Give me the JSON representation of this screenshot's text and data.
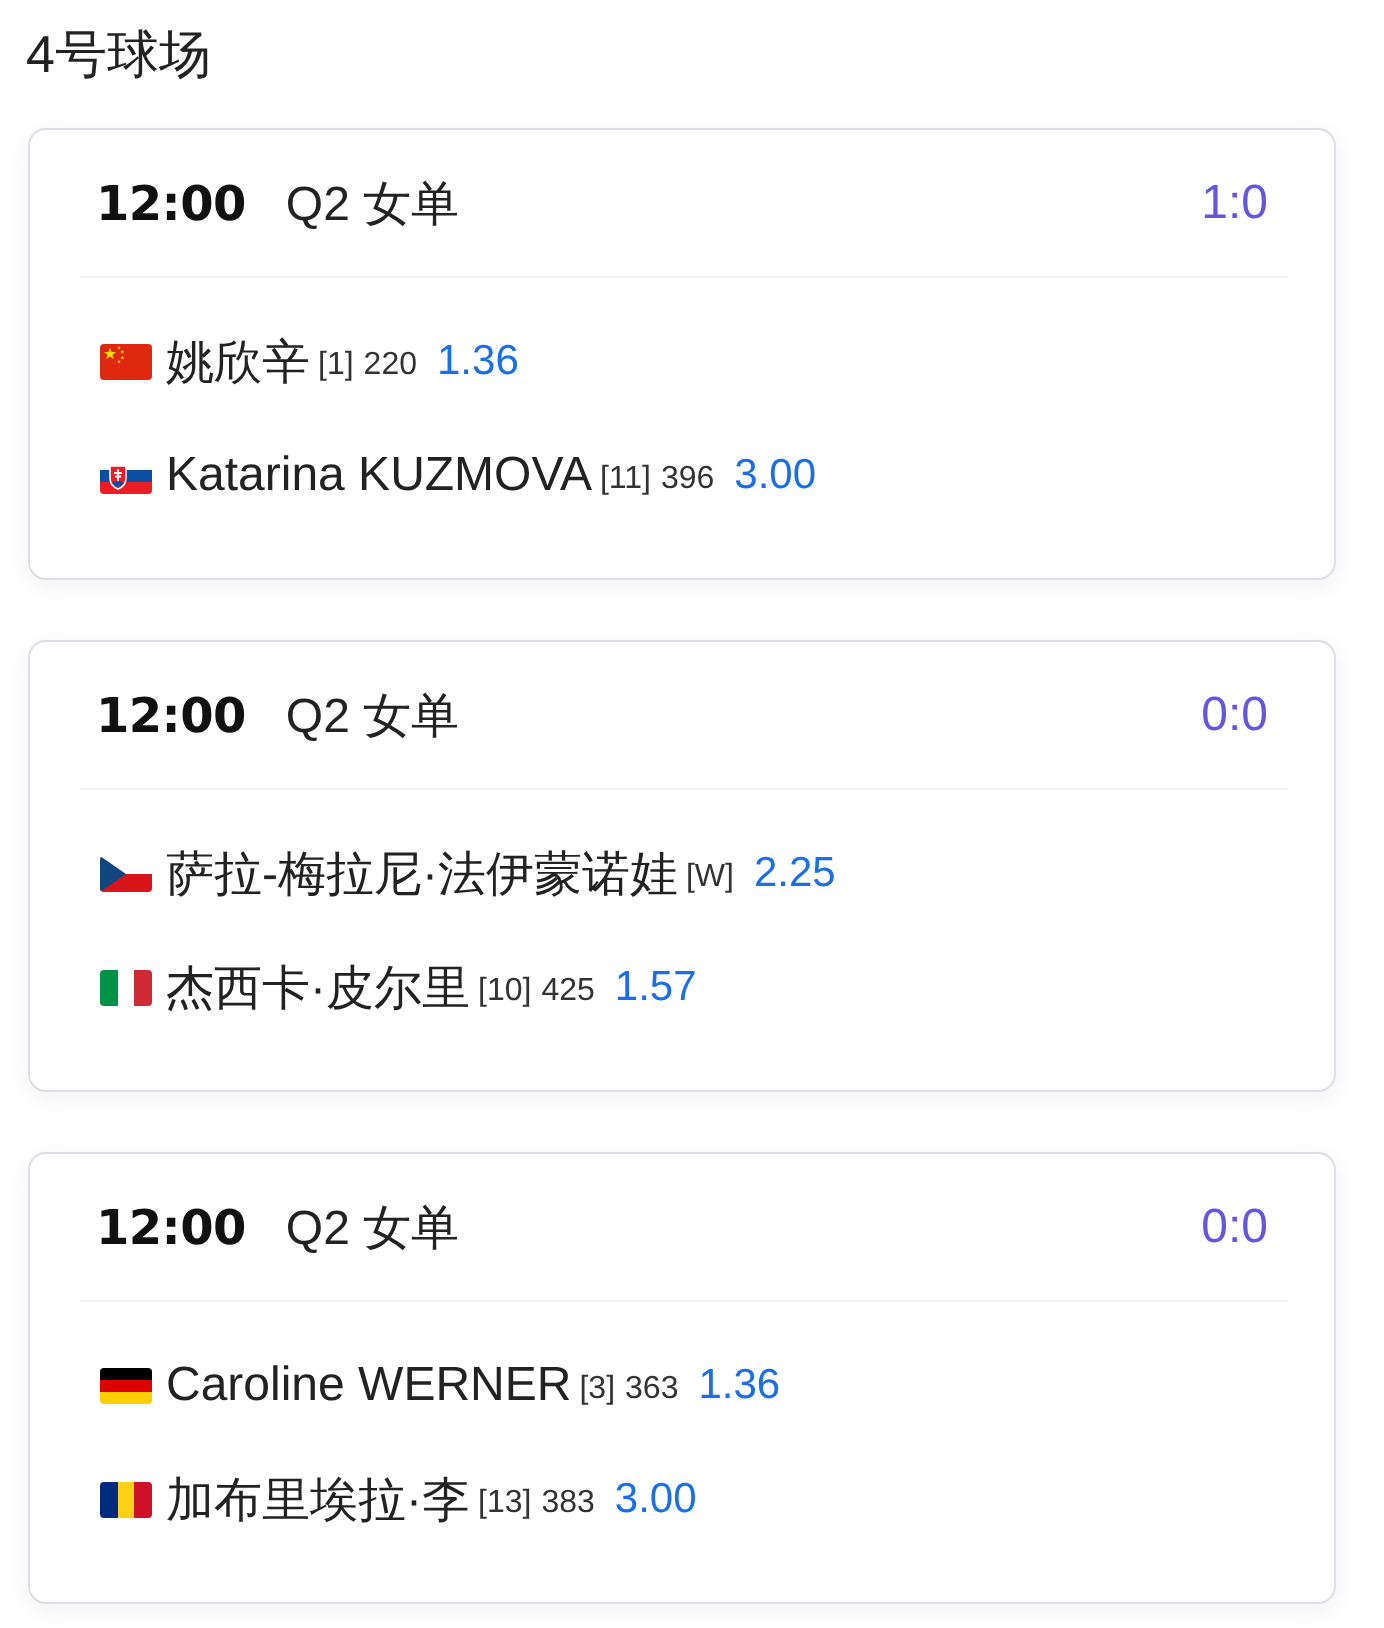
{
  "court": {
    "title": "4号球场"
  },
  "matches": [
    {
      "time": "12:00",
      "round": "Q2 女单",
      "score": "1:0",
      "players": [
        {
          "kind": "china",
          "name": "姚欣辛",
          "seed": "[1]",
          "ranking": "220",
          "odds": "1.36"
        },
        {
          "kind": "slovakia",
          "name": "Katarina KUZMOVA",
          "seed": "[11]",
          "ranking": "396",
          "odds": "3.00"
        }
      ]
    },
    {
      "time": "12:00",
      "round": "Q2 女单",
      "score": "0:0",
      "players": [
        {
          "kind": "czechia",
          "name": "萨拉-梅拉尼·法伊蒙诺娃",
          "seed": "[W]",
          "odds": "2.25"
        },
        {
          "kind": "italy",
          "name": "杰西卡·皮尔里",
          "seed": "[10]",
          "ranking": "425",
          "odds": "1.57"
        }
      ]
    },
    {
      "time": "12:00",
      "round": "Q2 女单",
      "score": "0:0",
      "players": [
        {
          "kind": "germany",
          "name": "Caroline WERNER",
          "seed": "[3]",
          "ranking": "363",
          "odds": "1.36"
        },
        {
          "kind": "romania",
          "name": "加布里埃拉·李",
          "seed": "[13]",
          "ranking": "383",
          "odds": "3.00"
        }
      ]
    }
  ]
}
